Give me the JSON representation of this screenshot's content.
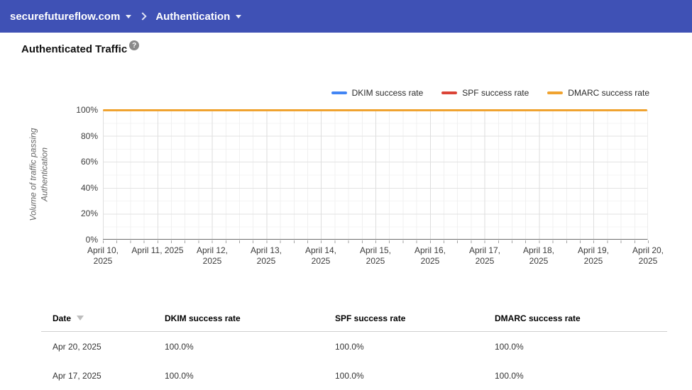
{
  "nav": {
    "domain_label": "securefutureflow.com",
    "section_label": "Authentication"
  },
  "page": {
    "title": "Authenticated Traffic"
  },
  "icons": {
    "help": "?"
  },
  "colors": {
    "header_bg": "#3F51B5",
    "dkim": "#4285F4",
    "spf": "#DB4437",
    "dmarc": "#F0A330"
  },
  "chart_data": {
    "type": "line",
    "title": "Authenticated Traffic",
    "ylabel": "Volume of traffic passing Authentication",
    "yticks": [
      "0%",
      "20%",
      "40%",
      "60%",
      "80%",
      "100%"
    ],
    "ylim": [
      0,
      100
    ],
    "grid": true,
    "legend_position": "top-right",
    "x": [
      "April 10, 2025",
      "April 11, 2025",
      "April 12, 2025",
      "April 13, 2025",
      "April 14, 2025",
      "April 15, 2025",
      "April 16, 2025",
      "April 17, 2025",
      "April 18, 2025",
      "April 19, 2025",
      "April 20, 2025"
    ],
    "series": [
      {
        "name": "DKIM success rate",
        "color": "#4285F4",
        "values": [
          100,
          100,
          100,
          100,
          100,
          100,
          100,
          100,
          100,
          100,
          100
        ]
      },
      {
        "name": "SPF success rate",
        "color": "#DB4437",
        "values": [
          100,
          100,
          100,
          100,
          100,
          100,
          100,
          100,
          100,
          100,
          100
        ]
      },
      {
        "name": "DMARC success rate",
        "color": "#F0A330",
        "values": [
          100,
          100,
          100,
          100,
          100,
          100,
          100,
          100,
          100,
          100,
          100
        ]
      }
    ]
  },
  "table": {
    "columns": [
      "Date",
      "DKIM success rate",
      "SPF success rate",
      "DMARC success rate"
    ],
    "rows": [
      {
        "date": "Apr 20, 2025",
        "dkim": "100.0%",
        "spf": "100.0%",
        "dmarc": "100.0%"
      },
      {
        "date": "Apr 17, 2025",
        "dkim": "100.0%",
        "spf": "100.0%",
        "dmarc": "100.0%"
      }
    ]
  }
}
